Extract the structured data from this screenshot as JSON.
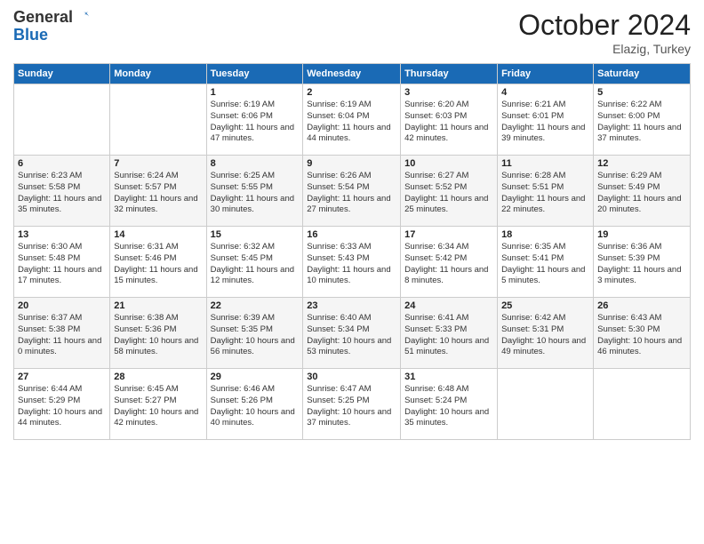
{
  "header": {
    "logo_line1": "General",
    "logo_line2": "Blue",
    "month": "October 2024",
    "location": "Elazig, Turkey"
  },
  "weekdays": [
    "Sunday",
    "Monday",
    "Tuesday",
    "Wednesday",
    "Thursday",
    "Friday",
    "Saturday"
  ],
  "weeks": [
    [
      {
        "num": "",
        "sunrise": "",
        "sunset": "",
        "daylight": ""
      },
      {
        "num": "",
        "sunrise": "",
        "sunset": "",
        "daylight": ""
      },
      {
        "num": "1",
        "sunrise": "Sunrise: 6:19 AM",
        "sunset": "Sunset: 6:06 PM",
        "daylight": "Daylight: 11 hours and 47 minutes."
      },
      {
        "num": "2",
        "sunrise": "Sunrise: 6:19 AM",
        "sunset": "Sunset: 6:04 PM",
        "daylight": "Daylight: 11 hours and 44 minutes."
      },
      {
        "num": "3",
        "sunrise": "Sunrise: 6:20 AM",
        "sunset": "Sunset: 6:03 PM",
        "daylight": "Daylight: 11 hours and 42 minutes."
      },
      {
        "num": "4",
        "sunrise": "Sunrise: 6:21 AM",
        "sunset": "Sunset: 6:01 PM",
        "daylight": "Daylight: 11 hours and 39 minutes."
      },
      {
        "num": "5",
        "sunrise": "Sunrise: 6:22 AM",
        "sunset": "Sunset: 6:00 PM",
        "daylight": "Daylight: 11 hours and 37 minutes."
      }
    ],
    [
      {
        "num": "6",
        "sunrise": "Sunrise: 6:23 AM",
        "sunset": "Sunset: 5:58 PM",
        "daylight": "Daylight: 11 hours and 35 minutes."
      },
      {
        "num": "7",
        "sunrise": "Sunrise: 6:24 AM",
        "sunset": "Sunset: 5:57 PM",
        "daylight": "Daylight: 11 hours and 32 minutes."
      },
      {
        "num": "8",
        "sunrise": "Sunrise: 6:25 AM",
        "sunset": "Sunset: 5:55 PM",
        "daylight": "Daylight: 11 hours and 30 minutes."
      },
      {
        "num": "9",
        "sunrise": "Sunrise: 6:26 AM",
        "sunset": "Sunset: 5:54 PM",
        "daylight": "Daylight: 11 hours and 27 minutes."
      },
      {
        "num": "10",
        "sunrise": "Sunrise: 6:27 AM",
        "sunset": "Sunset: 5:52 PM",
        "daylight": "Daylight: 11 hours and 25 minutes."
      },
      {
        "num": "11",
        "sunrise": "Sunrise: 6:28 AM",
        "sunset": "Sunset: 5:51 PM",
        "daylight": "Daylight: 11 hours and 22 minutes."
      },
      {
        "num": "12",
        "sunrise": "Sunrise: 6:29 AM",
        "sunset": "Sunset: 5:49 PM",
        "daylight": "Daylight: 11 hours and 20 minutes."
      }
    ],
    [
      {
        "num": "13",
        "sunrise": "Sunrise: 6:30 AM",
        "sunset": "Sunset: 5:48 PM",
        "daylight": "Daylight: 11 hours and 17 minutes."
      },
      {
        "num": "14",
        "sunrise": "Sunrise: 6:31 AM",
        "sunset": "Sunset: 5:46 PM",
        "daylight": "Daylight: 11 hours and 15 minutes."
      },
      {
        "num": "15",
        "sunrise": "Sunrise: 6:32 AM",
        "sunset": "Sunset: 5:45 PM",
        "daylight": "Daylight: 11 hours and 12 minutes."
      },
      {
        "num": "16",
        "sunrise": "Sunrise: 6:33 AM",
        "sunset": "Sunset: 5:43 PM",
        "daylight": "Daylight: 11 hours and 10 minutes."
      },
      {
        "num": "17",
        "sunrise": "Sunrise: 6:34 AM",
        "sunset": "Sunset: 5:42 PM",
        "daylight": "Daylight: 11 hours and 8 minutes."
      },
      {
        "num": "18",
        "sunrise": "Sunrise: 6:35 AM",
        "sunset": "Sunset: 5:41 PM",
        "daylight": "Daylight: 11 hours and 5 minutes."
      },
      {
        "num": "19",
        "sunrise": "Sunrise: 6:36 AM",
        "sunset": "Sunset: 5:39 PM",
        "daylight": "Daylight: 11 hours and 3 minutes."
      }
    ],
    [
      {
        "num": "20",
        "sunrise": "Sunrise: 6:37 AM",
        "sunset": "Sunset: 5:38 PM",
        "daylight": "Daylight: 11 hours and 0 minutes."
      },
      {
        "num": "21",
        "sunrise": "Sunrise: 6:38 AM",
        "sunset": "Sunset: 5:36 PM",
        "daylight": "Daylight: 10 hours and 58 minutes."
      },
      {
        "num": "22",
        "sunrise": "Sunrise: 6:39 AM",
        "sunset": "Sunset: 5:35 PM",
        "daylight": "Daylight: 10 hours and 56 minutes."
      },
      {
        "num": "23",
        "sunrise": "Sunrise: 6:40 AM",
        "sunset": "Sunset: 5:34 PM",
        "daylight": "Daylight: 10 hours and 53 minutes."
      },
      {
        "num": "24",
        "sunrise": "Sunrise: 6:41 AM",
        "sunset": "Sunset: 5:33 PM",
        "daylight": "Daylight: 10 hours and 51 minutes."
      },
      {
        "num": "25",
        "sunrise": "Sunrise: 6:42 AM",
        "sunset": "Sunset: 5:31 PM",
        "daylight": "Daylight: 10 hours and 49 minutes."
      },
      {
        "num": "26",
        "sunrise": "Sunrise: 6:43 AM",
        "sunset": "Sunset: 5:30 PM",
        "daylight": "Daylight: 10 hours and 46 minutes."
      }
    ],
    [
      {
        "num": "27",
        "sunrise": "Sunrise: 6:44 AM",
        "sunset": "Sunset: 5:29 PM",
        "daylight": "Daylight: 10 hours and 44 minutes."
      },
      {
        "num": "28",
        "sunrise": "Sunrise: 6:45 AM",
        "sunset": "Sunset: 5:27 PM",
        "daylight": "Daylight: 10 hours and 42 minutes."
      },
      {
        "num": "29",
        "sunrise": "Sunrise: 6:46 AM",
        "sunset": "Sunset: 5:26 PM",
        "daylight": "Daylight: 10 hours and 40 minutes."
      },
      {
        "num": "30",
        "sunrise": "Sunrise: 6:47 AM",
        "sunset": "Sunset: 5:25 PM",
        "daylight": "Daylight: 10 hours and 37 minutes."
      },
      {
        "num": "31",
        "sunrise": "Sunrise: 6:48 AM",
        "sunset": "Sunset: 5:24 PM",
        "daylight": "Daylight: 10 hours and 35 minutes."
      },
      {
        "num": "",
        "sunrise": "",
        "sunset": "",
        "daylight": ""
      },
      {
        "num": "",
        "sunrise": "",
        "sunset": "",
        "daylight": ""
      }
    ]
  ]
}
